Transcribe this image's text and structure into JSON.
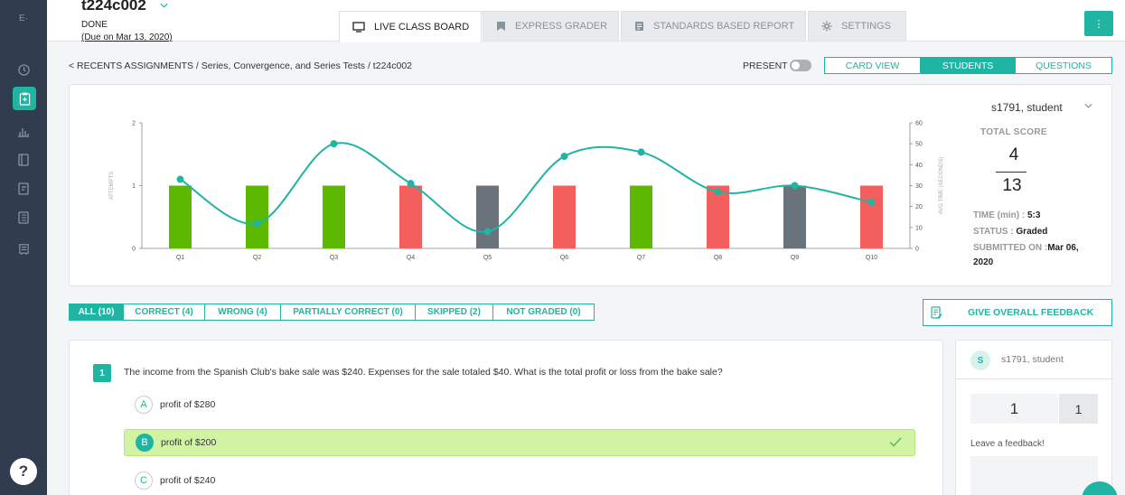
{
  "sidebar": {
    "logo": "E",
    "logo_dot": "·",
    "items": [
      "clock-icon",
      "assignment-icon",
      "bar-chart-icon",
      "book-icon",
      "book-alt-icon",
      "notebook-icon",
      "report-icon"
    ],
    "help_label": "?"
  },
  "header": {
    "assignment_title": "t224c002",
    "status": "DONE",
    "due": "(Due on Mar 13, 2020)",
    "tabs": [
      {
        "label": "LIVE CLASS BOARD",
        "icon": "monitor-icon",
        "active": true
      },
      {
        "label": "EXPRESS GRADER",
        "icon": "bookmark-icon",
        "active": false
      },
      {
        "label": "STANDARDS BASED REPORT",
        "icon": "report-icon",
        "active": false
      },
      {
        "label": "SETTINGS",
        "icon": "gear-icon",
        "active": false
      }
    ],
    "menu_label": "⋮"
  },
  "breadcrumb": "< RECENTS ASSIGNMENTS / Series, Convergence, and Series Tests / t224c002",
  "present_label": "PRESENT",
  "views": [
    {
      "label": "CARD VIEW",
      "active": false
    },
    {
      "label": "STUDENTS",
      "active": true
    },
    {
      "label": "QUESTIONS",
      "active": false
    }
  ],
  "colors": {
    "accent": "#1fb5a2",
    "correct": "#5cb800",
    "wrong": "#f25f5c",
    "skipped": "#6a727c",
    "line": "#1fb5a2"
  },
  "chart_data": {
    "type": "bar",
    "categories": [
      "Q1",
      "Q2",
      "Q3",
      "Q4",
      "Q5",
      "Q6",
      "Q7",
      "Q8",
      "Q9",
      "Q10"
    ],
    "ylabel": "ATTEMPTS",
    "y2label": "AVG TIME (SECONDS)",
    "ylim": [
      0,
      2
    ],
    "y2lim": [
      0,
      60
    ],
    "yticks": [
      0,
      1,
      2
    ],
    "y2ticks": [
      0,
      10,
      20,
      30,
      40,
      50,
      60
    ],
    "series": [
      {
        "values": [
          1,
          1,
          1,
          1,
          1,
          1,
          1,
          1,
          1,
          1
        ],
        "statuses": [
          "correct",
          "correct",
          "correct",
          "wrong",
          "skipped",
          "wrong",
          "correct",
          "wrong",
          "skipped",
          "wrong"
        ]
      },
      {
        "values": [
          33,
          12,
          50,
          31,
          8,
          44,
          46,
          27,
          30,
          22
        ],
        "axis": "right"
      }
    ]
  },
  "student_panel": {
    "name": "s1791, student",
    "total_score_label": "TOTAL SCORE",
    "score": "4",
    "max_score": "13",
    "time_label": "TIME (min) : ",
    "time_value": "5:3",
    "status_label": "STATUS : ",
    "status_value": "Graded",
    "submitted_label": "SUBMITTED ON :",
    "submitted_value": "Mar 06,",
    "submitted_year": "2020"
  },
  "filters": [
    {
      "label": "ALL (10)",
      "active": true
    },
    {
      "label": "CORRECT (4)",
      "active": false
    },
    {
      "label": "WRONG (4)",
      "active": false
    },
    {
      "label": "PARTIALLY CORRECT (0)",
      "active": false
    },
    {
      "label": "SKIPPED (2)",
      "active": false
    },
    {
      "label": "NOT GRADED (0)",
      "active": false
    }
  ],
  "feedback_button_label": "GIVE OVERALL FEEDBACK",
  "question": {
    "number": "1",
    "text": "The income from the Spanish Club's bake sale was $240.  Expenses for the sale totaled $40.  What is the total profit or loss from the bake sale?",
    "options": [
      {
        "letter": "A",
        "text": "profit of $280",
        "correct": false
      },
      {
        "letter": "B",
        "text": "profit of $200",
        "correct": true
      },
      {
        "letter": "C",
        "text": "profit of $240",
        "correct": false
      }
    ]
  },
  "feedback_panel": {
    "avatar_initial": "S",
    "student": "s1791, student",
    "score": "1",
    "max": "1",
    "prompt": "Leave a feedback!"
  }
}
